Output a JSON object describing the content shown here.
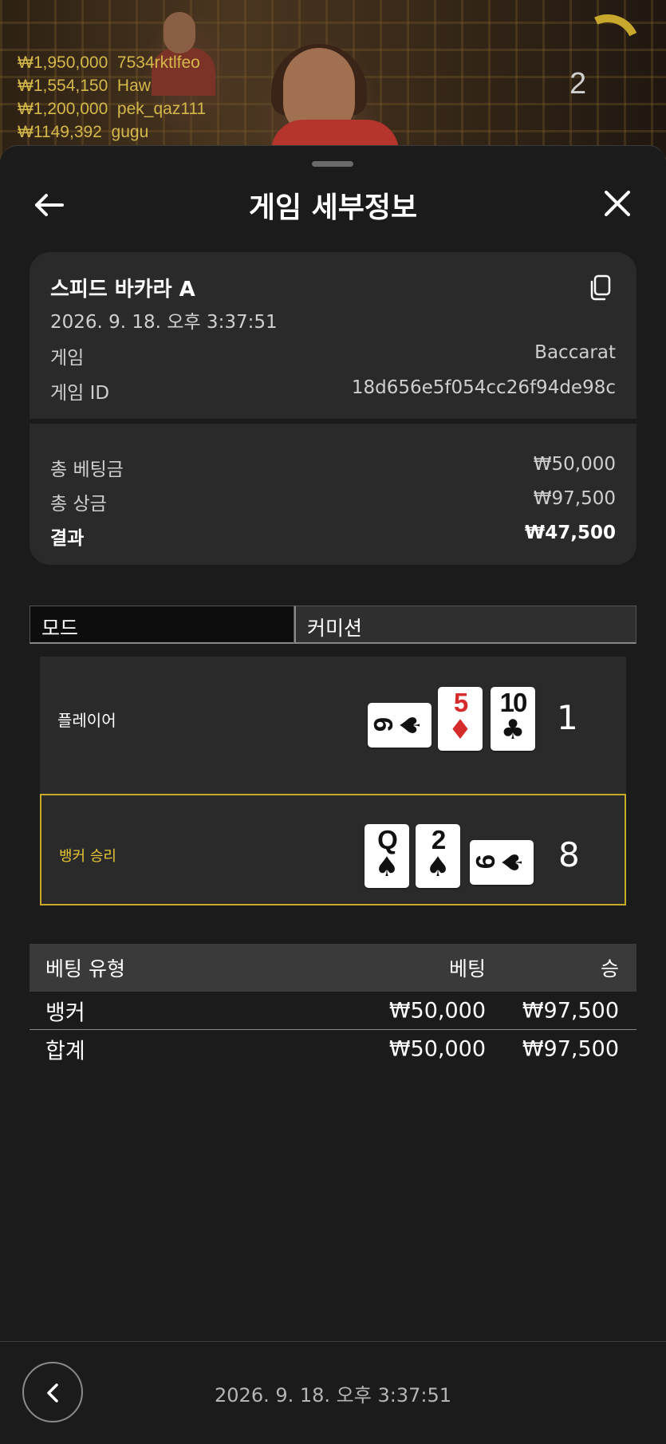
{
  "stream": {
    "winners": [
      {
        "amount": "₩1,950,000",
        "name": "7534rktlfeo"
      },
      {
        "amount": "₩1,554,150",
        "name": "Haw"
      },
      {
        "amount": "₩1,200,000",
        "name": "pek_qaz111"
      },
      {
        "amount": "₩1149,392",
        "name": "gugu"
      }
    ],
    "round_number": "2"
  },
  "header": {
    "title": "게임 세부정보",
    "back_icon": "arrow-left-icon",
    "close_icon": "close-icon"
  },
  "summary": {
    "game_name": "스피드 바카라 A",
    "datetime": "2026. 9. 18. 오후 3:37:51",
    "copy_icon": "copy-icon",
    "game_label": "게임",
    "game_value": "Baccarat",
    "game_id_label": "게임 ID",
    "game_id_value": "18d656e5f054cc26f94de98c",
    "total_bet_label": "총 베팅금",
    "total_bet_value": "₩50,000",
    "total_win_label": "총 상금",
    "total_win_value": "₩97,500",
    "result_label": "결과",
    "result_value": "₩47,500"
  },
  "tabs": {
    "mode": "모드",
    "commission": "커미션"
  },
  "hands": {
    "player": {
      "label": "플레이어",
      "score": "1",
      "cards": [
        {
          "rank": "9",
          "suit": "♠",
          "orientation": "sideways"
        },
        {
          "rank": "5",
          "suit": "♦",
          "orientation": "upright"
        },
        {
          "rank": "10",
          "suit": "♣",
          "orientation": "upright"
        }
      ]
    },
    "banker": {
      "label": "뱅커 승리",
      "score": "8",
      "cards": [
        {
          "rank": "Q",
          "suit": "♠",
          "orientation": "upright"
        },
        {
          "rank": "2",
          "suit": "♠",
          "orientation": "upright"
        },
        {
          "rank": "6",
          "suit": "♠",
          "orientation": "sideways"
        }
      ]
    }
  },
  "bets_table": {
    "headers": [
      "베팅 유형",
      "베팅",
      "승"
    ],
    "rows": [
      [
        "뱅커",
        "₩50,000",
        "₩97,500"
      ],
      [
        "합계",
        "₩50,000",
        "₩97,500"
      ]
    ]
  },
  "footer": {
    "back_icon": "chevron-left-icon",
    "datetime": "2026. 9. 18. 오후 3:37:51"
  },
  "colors": {
    "background": "#1b1b1b",
    "panel": "#2a2a2a",
    "banker_highlight": "#c8aa28",
    "red_suit": "#d52b2b"
  }
}
